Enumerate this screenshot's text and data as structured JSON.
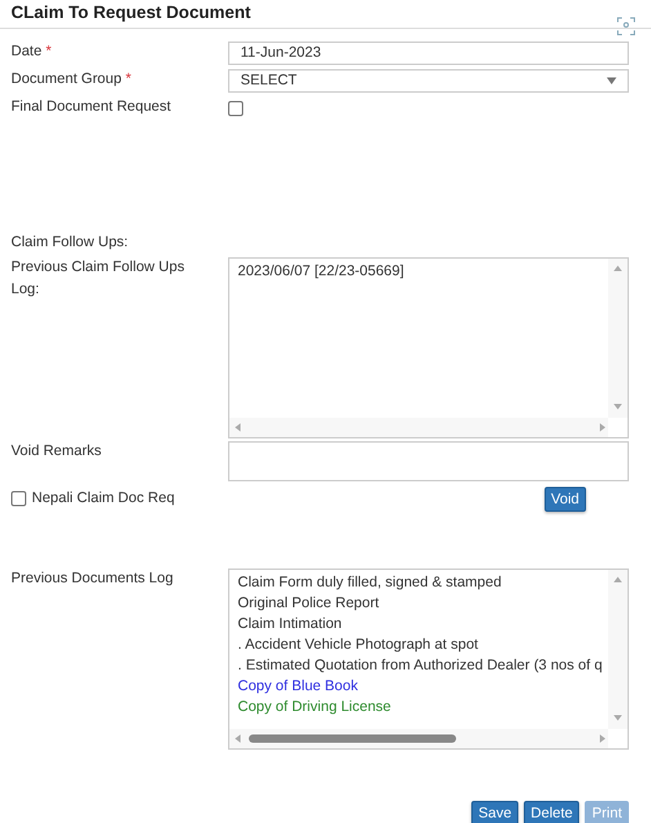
{
  "title": "CLaim To Request Document",
  "fields": [
    {
      "label": "Date",
      "required_mark": "*",
      "kind": "text",
      "value": "11-Jun-2023"
    },
    {
      "label": "Document Group",
      "required_mark": "*",
      "kind": "select",
      "value": "SELECT"
    },
    {
      "label": "Final Document Request",
      "kind": "checkbox",
      "checked": false
    }
  ],
  "section_label": "Claim Follow Ups:",
  "follow_ups_log": {
    "label": "Previous Claim Follow Ups Log:",
    "lines": [
      "2023/06/07 [22/23-05669]"
    ]
  },
  "void_remarks": {
    "label": "Void Remarks"
  },
  "nepali_claim": {
    "label": "Nepali Claim Doc Req",
    "checked": false
  },
  "void_button": {
    "label": "Void"
  },
  "documents_log": {
    "label": "Previous Documents Log",
    "items": [
      {
        "text": "Claim Form duly filled, signed & stamped",
        "color": "#333333"
      },
      {
        "text": "Original Police Report",
        "color": "#333333"
      },
      {
        "text": "Claim Intimation",
        "color": "#333333"
      },
      {
        "text": ". Accident Vehicle Photograph at spot",
        "color": "#333333"
      },
      {
        "text": ". Estimated Quotation from Authorized Dealer (3 nos of q",
        "color": "#333333"
      },
      {
        "text": "Copy of Blue Book",
        "color": "#2f2fe0"
      },
      {
        "text": "Copy of Driving License",
        "color": "#2e8b2e"
      }
    ]
  },
  "buttons": [
    {
      "label": "Save",
      "disabled": false
    },
    {
      "label": "Delete",
      "disabled": false
    },
    {
      "label": "Print",
      "disabled": true
    }
  ]
}
